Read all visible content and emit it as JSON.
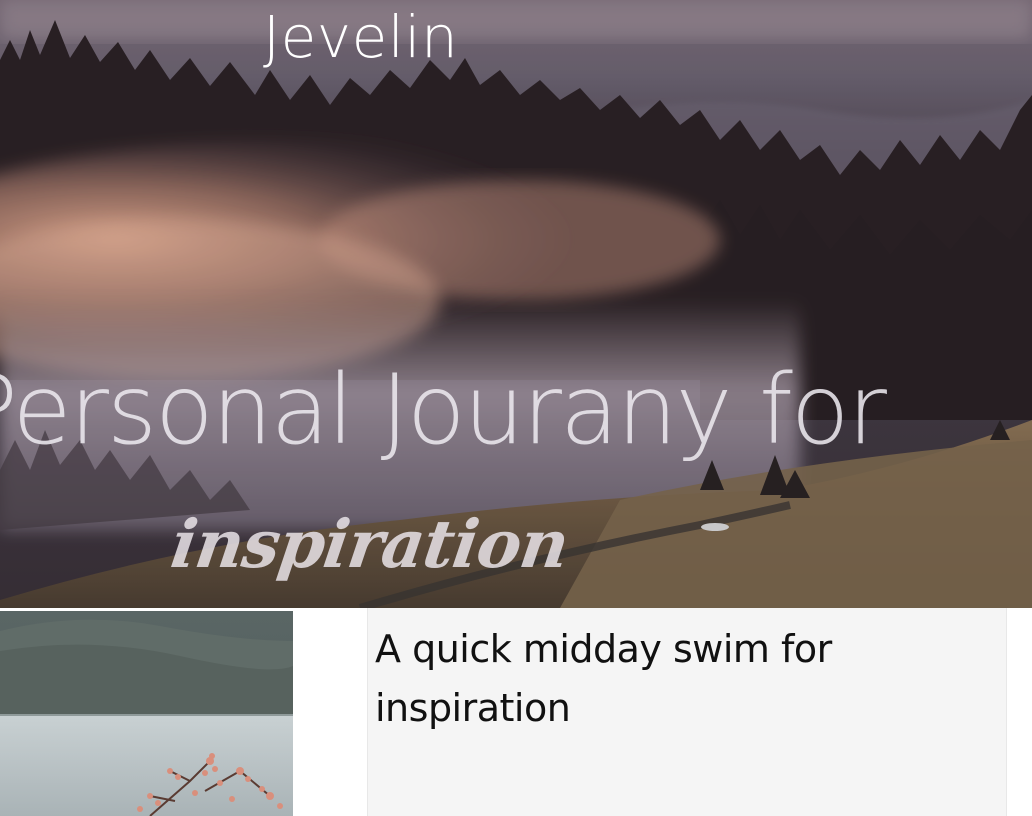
{
  "header": {
    "logo_text": "Jevelin"
  },
  "hero": {
    "heading": "Personal Jourany for",
    "script_text": "inspiration"
  },
  "featured_post": {
    "title": "A quick midday swim for inspiration"
  },
  "colors": {
    "hero_text": "#ECE8EE",
    "card_background": "#F5F5F5",
    "title_text": "#111111"
  }
}
